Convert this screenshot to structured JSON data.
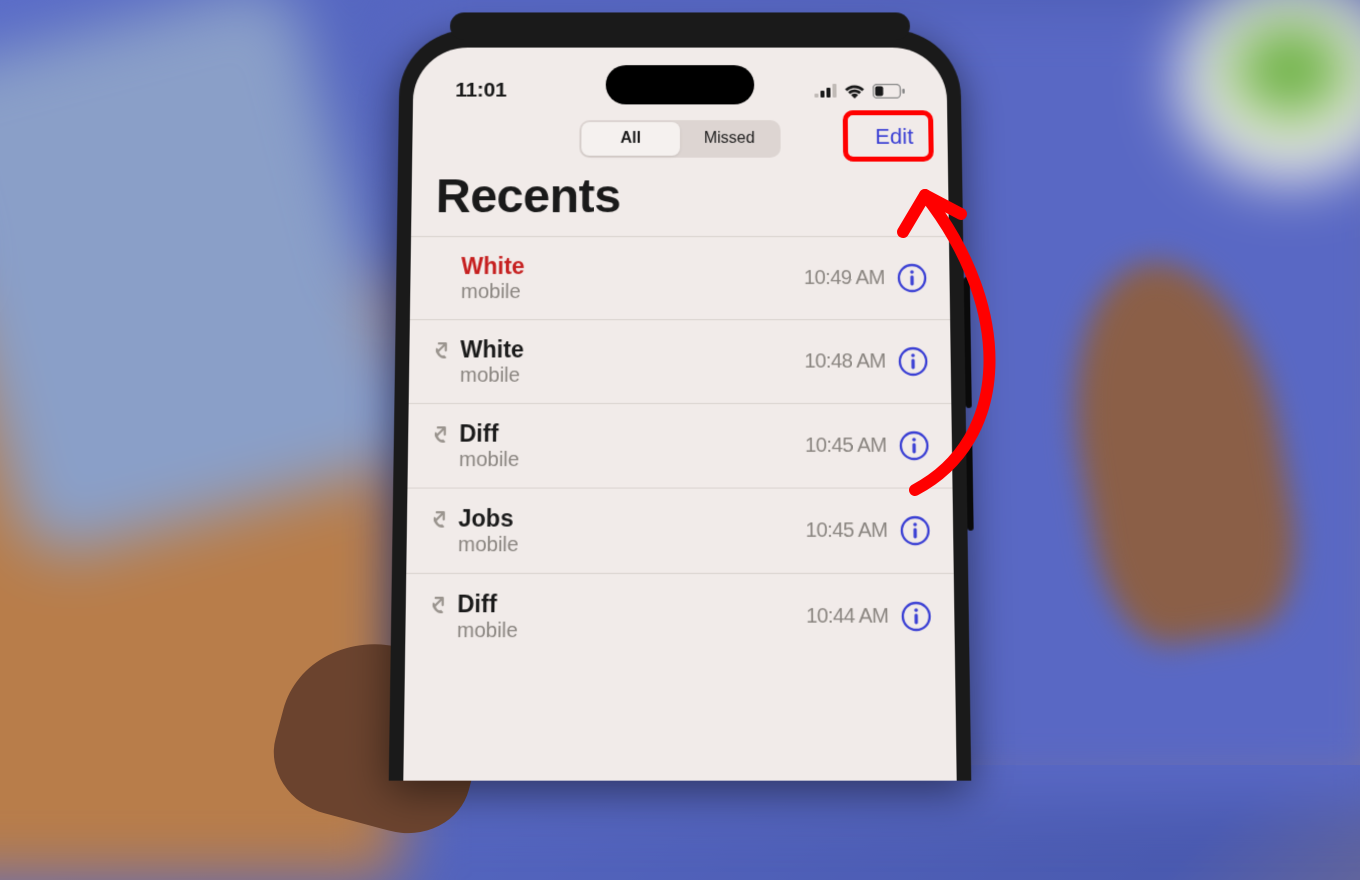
{
  "status": {
    "time": "11:01"
  },
  "toolbar": {
    "segments": [
      "All",
      "Missed"
    ],
    "edit": "Edit"
  },
  "title": "Recents",
  "calls": [
    {
      "name": "White",
      "label": "mobile",
      "time": "10:49 AM",
      "missed": true,
      "outgoing": false
    },
    {
      "name": "White",
      "label": "mobile",
      "time": "10:48 AM",
      "missed": false,
      "outgoing": true
    },
    {
      "name": "Diff",
      "label": "mobile",
      "time": "10:45 AM",
      "missed": false,
      "outgoing": true
    },
    {
      "name": "Jobs",
      "label": "mobile",
      "time": "10:45 AM",
      "missed": false,
      "outgoing": true
    },
    {
      "name": "Diff",
      "label": "mobile",
      "time": "10:44 AM",
      "missed": false,
      "outgoing": true
    }
  ],
  "colors": {
    "accent": "#3a3fd4",
    "missed": "#c62020",
    "annotation": "#ff0000"
  }
}
